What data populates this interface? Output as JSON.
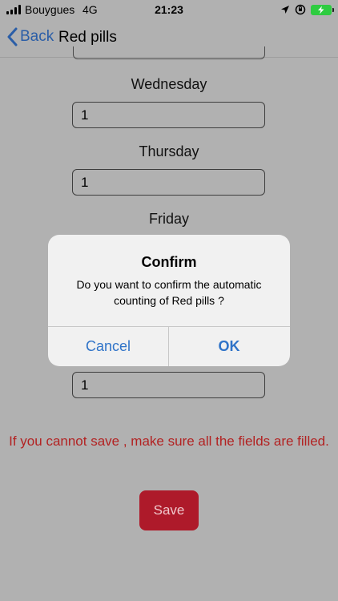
{
  "status_bar": {
    "carrier": "Bouygues",
    "network": "4G",
    "time": "21:23"
  },
  "nav": {
    "back_label": "Back",
    "title": "Red pills"
  },
  "days": [
    {
      "label": "Wednesday",
      "value": "1"
    },
    {
      "label": "Thursday",
      "value": "1"
    },
    {
      "label": "Friday"
    },
    {
      "value": "1"
    }
  ],
  "warning": "If you cannot save , make sure all the fields are filled.",
  "save_label": "Save",
  "alert": {
    "title": "Confirm",
    "message": "Do you want to confirm the automatic counting of Red pills ?",
    "cancel_label": "Cancel",
    "ok_label": "OK"
  },
  "colors": {
    "accent": "#2f73c8",
    "warning": "#b22222",
    "save_button": "#ae1a2a",
    "battery": "#2ecc40"
  }
}
